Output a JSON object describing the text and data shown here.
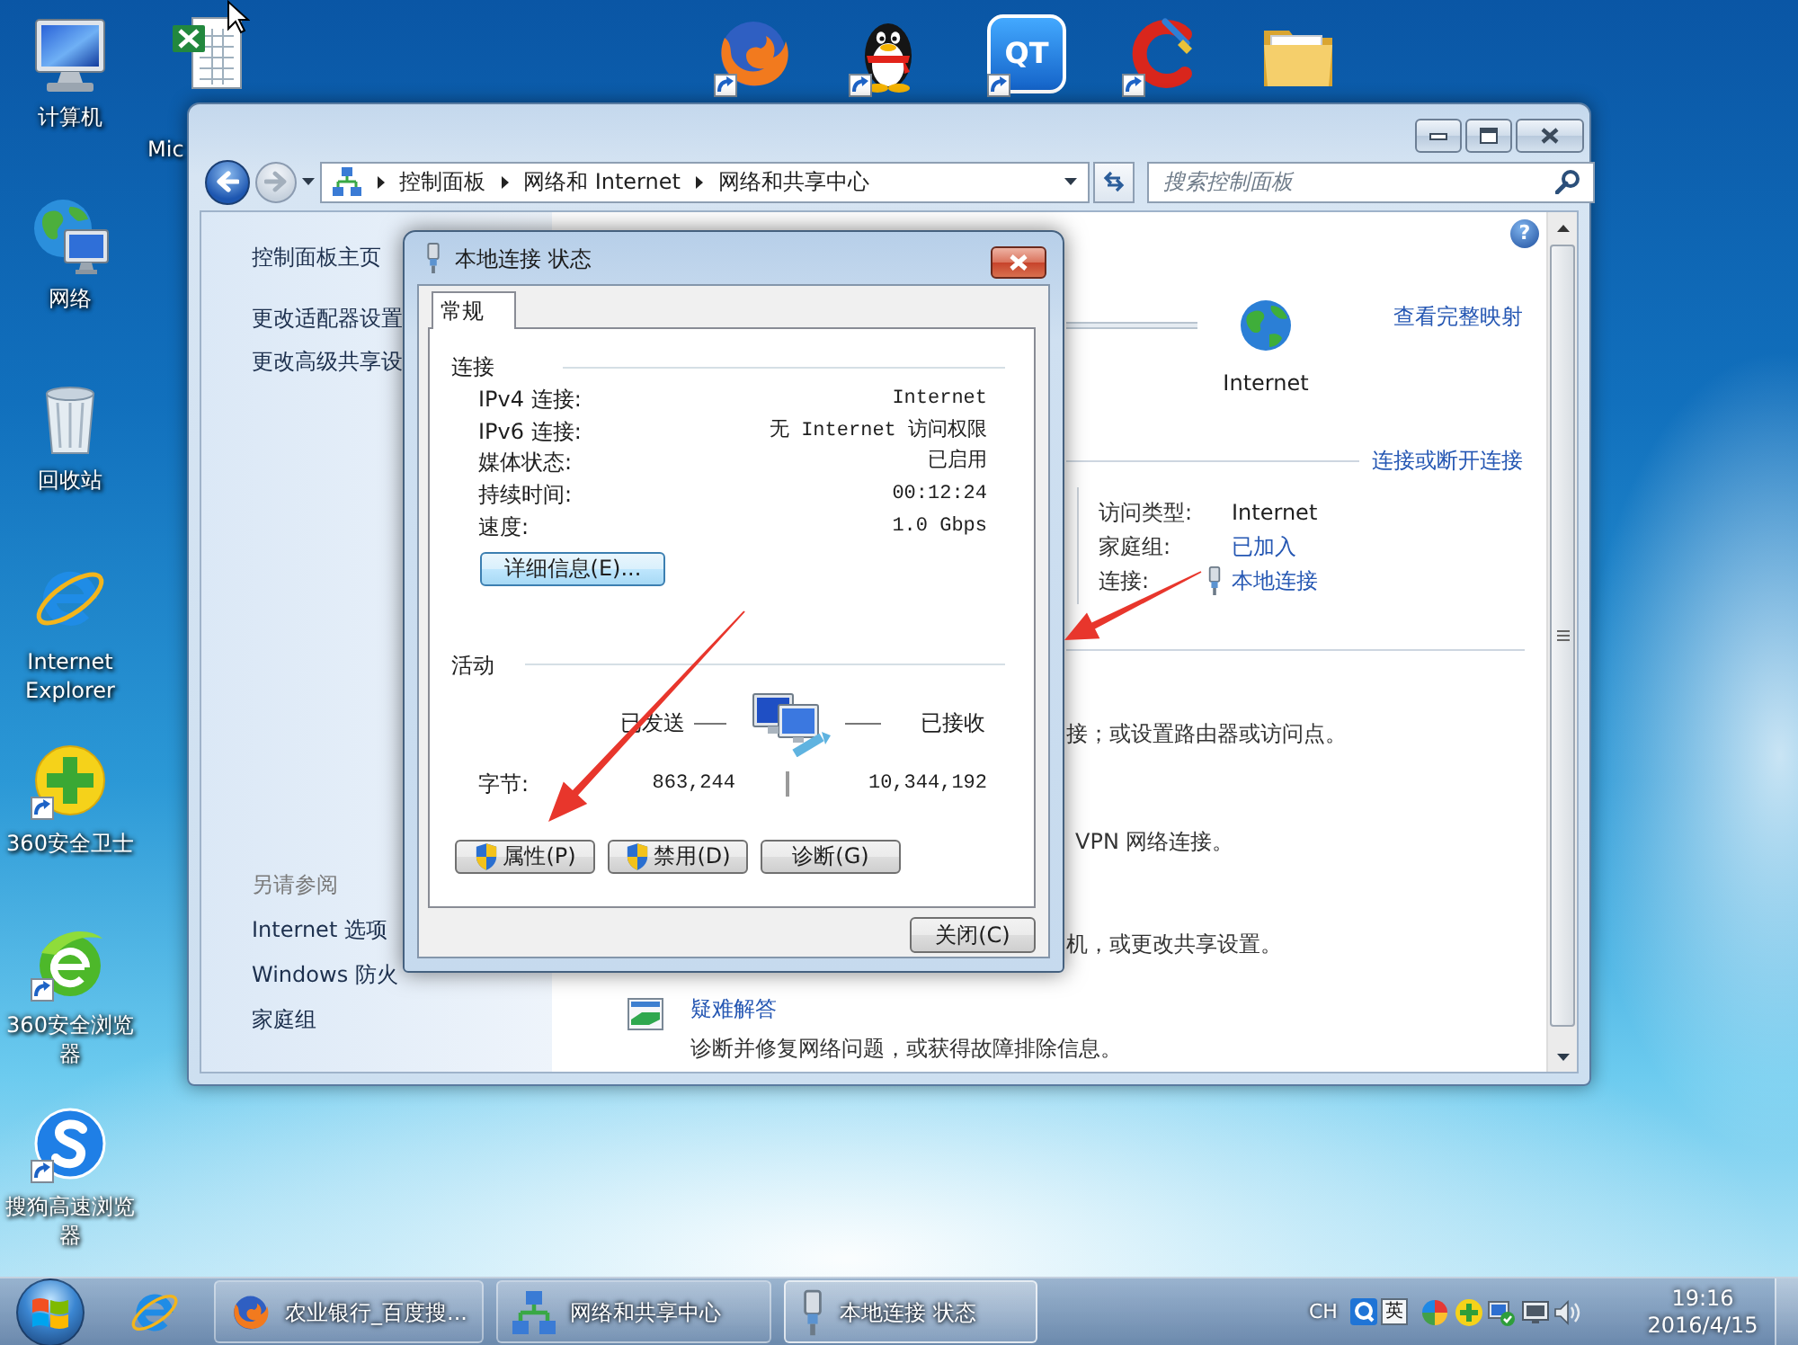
{
  "desktop": {
    "icons": [
      {
        "label": "计算机",
        "kind": "computer",
        "shortcut": false
      },
      {
        "label": "网络",
        "kind": "network",
        "shortcut": false
      },
      {
        "label": "回收站",
        "kind": "recycle_bin",
        "shortcut": false
      },
      {
        "label": "Internet Explorer",
        "kind": "ie",
        "shortcut": false
      },
      {
        "label": "360安全卫士",
        "kind": "guard",
        "shortcut": true
      },
      {
        "label": "360安全浏览器",
        "kind": "green_browser",
        "shortcut": true
      },
      {
        "label": "搜狗高速浏览器",
        "kind": "sogou",
        "shortcut": true
      }
    ],
    "top_icons": [
      {
        "label": "Mic",
        "kind": "spreadsheet",
        "shortcut": false
      },
      {
        "kind": "firefox",
        "shortcut": true
      },
      {
        "kind": "penguin",
        "shortcut": true
      },
      {
        "kind": "logo_tile",
        "logo": "QT",
        "shortcut": true
      },
      {
        "kind": "cleaner",
        "shortcut": true
      },
      {
        "kind": "folder",
        "shortcut": false
      }
    ]
  },
  "explorer": {
    "breadcrumbs": [
      "控制面板",
      "网络和 Internet",
      "网络和共享中心"
    ],
    "search": {
      "placeholder": "搜索控制面板"
    },
    "help": "?",
    "sidebar": {
      "tasks": [
        "控制面板主页",
        "更改适配器设置",
        "更改高级共享设"
      ],
      "see_also_title": "另请参阅",
      "see_also": [
        "Internet 选项",
        "Windows 防火",
        "家庭组"
      ]
    },
    "network_map": {
      "node": "Internet",
      "link": "查看完整映射"
    },
    "connections": {
      "link": "连接或断开连接",
      "details": [
        {
          "label": "访问类型:",
          "value": "Internet",
          "kind": "text"
        },
        {
          "label": "家庭组:",
          "value": "已加入",
          "kind": "link"
        },
        {
          "label": "连接:",
          "value": "本地连接",
          "kind": "connection"
        }
      ]
    },
    "partial_lines": [
      "接；或设置路由器或访问点。",
      "VPN 网络连接。",
      "机，或更改共享设置。"
    ],
    "troubleshoot": {
      "title": "疑难解答",
      "description": "诊断并修复网络问题，或获得故障排除信息。"
    }
  },
  "dialog": {
    "title": "本地连接 状态",
    "tabs": [
      {
        "label": "常规",
        "selected": true
      }
    ],
    "connection": {
      "title": "连接",
      "rows": [
        {
          "label": "IPv4 连接:",
          "value": "Internet"
        },
        {
          "label": "IPv6 连接:",
          "value": "无 Internet 访问权限"
        },
        {
          "label": "媒体状态:",
          "value": "已启用"
        },
        {
          "label": "持续时间:",
          "value": "00:12:24"
        },
        {
          "label": "速度:",
          "value": "1.0 Gbps"
        }
      ],
      "details_button": "详细信息(E)..."
    },
    "activity": {
      "title": "活动",
      "sent": "已发送",
      "received": "已接收",
      "bytes_label": "字节:",
      "bytes_sent": "863,244",
      "bytes_received": "10,344,192"
    },
    "buttons": [
      {
        "label": "属性(P)",
        "shield": true
      },
      {
        "label": "禁用(D)",
        "shield": true
      },
      {
        "label": "诊断(G)",
        "shield": false
      }
    ],
    "close_button": "关闭(C)"
  },
  "taskbar": {
    "tasks": [
      {
        "label": "农业银行_百度搜...",
        "kind": "firefox",
        "selected": false
      },
      {
        "label": "网络和共享中心",
        "kind": "network",
        "selected": false
      },
      {
        "label": "本地连接 状态",
        "kind": "plug",
        "selected": true
      }
    ],
    "tray": {
      "language": "CH",
      "ime": "英",
      "time": "19:16",
      "date": "2016/4/15"
    }
  }
}
